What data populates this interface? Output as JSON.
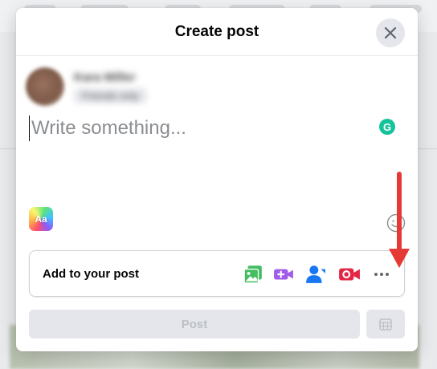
{
  "modal": {
    "title": "Create post",
    "close_icon": "close-icon"
  },
  "user": {
    "name": "Kara Miller",
    "audience": "Friends only",
    "avatar_icon": "user-avatar"
  },
  "composer": {
    "placeholder": "Write something...",
    "value": ""
  },
  "toolbar": {
    "text_style_label": "Aa",
    "emoji_icon": "smiley-icon",
    "grammarly_label": "G"
  },
  "add_to_post": {
    "label": "Add to your post",
    "icons": [
      {
        "name": "photo-video-icon",
        "color": "#45bd62"
      },
      {
        "name": "live-video-icon",
        "color": "#a05ce8"
      },
      {
        "name": "tag-people-icon",
        "color": "#1877f2"
      },
      {
        "name": "video-call-icon",
        "color": "#e42645"
      },
      {
        "name": "more-icon",
        "color": "#65676b"
      }
    ]
  },
  "post_button": {
    "label": "Post",
    "enabled": false
  },
  "schedule_icon": "calendar-icon",
  "annotation": {
    "arrow_color": "#e53935",
    "points_to": "more-icon"
  }
}
